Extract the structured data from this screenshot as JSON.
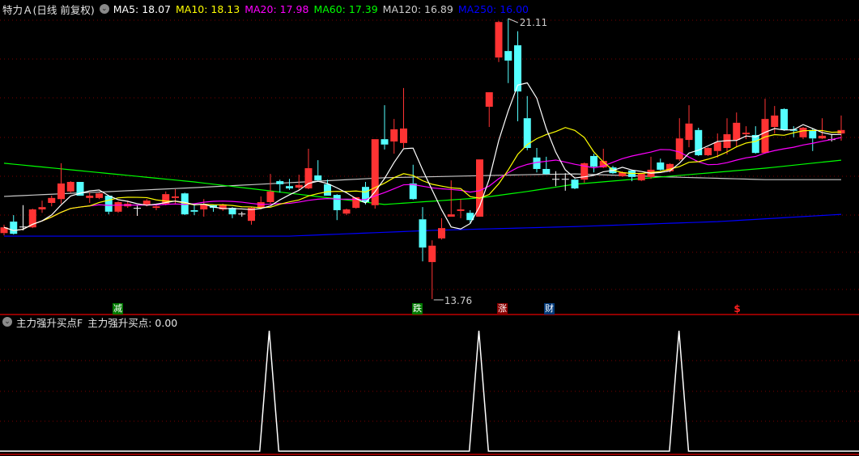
{
  "header": {
    "title": "特力Ａ(日线 前复权)",
    "ma_labels": [
      {
        "text": "MA5: 18.07",
        "color": "#ffffff"
      },
      {
        "text": "MA10: 18.13",
        "color": "#ffff00"
      },
      {
        "text": "MA20: 17.98",
        "color": "#ff00ff"
      },
      {
        "text": "MA60: 17.39",
        "color": "#00ff00"
      },
      {
        "text": "MA120: 16.89",
        "color": "#cccccc"
      },
      {
        "text": "MA250: 16.00",
        "color": "#0000ff"
      }
    ]
  },
  "annotations": {
    "high_label": "21.11",
    "low_label": "13.76"
  },
  "markers": [
    {
      "text": "减",
      "bg": "#007a00",
      "color": "#ffffff"
    },
    {
      "text": "跌",
      "bg": "#007a00",
      "color": "#ffffff"
    },
    {
      "text": "涨",
      "bg": "#8b0000",
      "color": "#ffffff"
    },
    {
      "text": "财",
      "bg": "#003a7a",
      "color": "#ffffff"
    },
    {
      "text": "$",
      "bg": "transparent",
      "color": "#ff2020"
    }
  ],
  "indicator": {
    "name": "主力强升买点F",
    "value_label": "主力强升买点: 0.00"
  },
  "colors": {
    "up": "#ff3333",
    "down": "#54ffff",
    "grid": "#7a0000",
    "separator": "#c00000"
  },
  "chart_data": {
    "type": "candlestick",
    "title": "特力Ａ(日线 前复权)",
    "ylim": [
      13.6,
      21.2
    ],
    "candles_ohlc": [
      [
        15.49,
        15.71,
        15.43,
        15.64
      ],
      [
        15.79,
        15.96,
        15.45,
        15.47
      ],
      [
        15.66,
        16.22,
        15.56,
        15.66
      ],
      [
        15.64,
        16.13,
        15.62,
        16.11
      ],
      [
        16.11,
        16.34,
        16.02,
        16.17
      ],
      [
        16.28,
        16.47,
        16.19,
        16.41
      ],
      [
        16.38,
        17.32,
        16.26,
        16.79
      ],
      [
        16.58,
        16.85,
        16.55,
        16.83
      ],
      [
        16.83,
        16.83,
        16.47,
        16.47
      ],
      [
        16.41,
        16.55,
        16.28,
        16.47
      ],
      [
        16.41,
        16.55,
        16.38,
        16.53
      ],
      [
        16.47,
        16.47,
        15.98,
        16.05
      ],
      [
        16.05,
        16.32,
        16.02,
        16.3
      ],
      [
        16.19,
        16.34,
        16.15,
        16.26
      ],
      [
        16.15,
        16.22,
        15.94,
        16.15
      ],
      [
        16.24,
        16.38,
        16.19,
        16.34
      ],
      [
        16.15,
        16.26,
        16.09,
        16.19
      ],
      [
        16.24,
        16.58,
        16.22,
        16.51
      ],
      [
        16.41,
        16.64,
        16.24,
        16.45
      ],
      [
        16.53,
        16.55,
        15.96,
        15.98
      ],
      [
        16.09,
        16.24,
        15.96,
        16.05
      ],
      [
        16.11,
        16.38,
        15.92,
        16.24
      ],
      [
        16.22,
        16.24,
        16.05,
        16.15
      ],
      [
        16.11,
        16.26,
        16.07,
        16.24
      ],
      [
        16.15,
        16.17,
        15.88,
        15.98
      ],
      [
        15.98,
        16.05,
        15.92,
        16.0
      ],
      [
        15.81,
        16.17,
        15.71,
        16.15
      ],
      [
        16.15,
        16.45,
        16.11,
        16.3
      ],
      [
        16.3,
        17.04,
        16.26,
        16.58
      ],
      [
        16.85,
        16.89,
        16.55,
        16.77
      ],
      [
        16.72,
        16.91,
        16.62,
        16.66
      ],
      [
        16.68,
        17.02,
        16.62,
        16.75
      ],
      [
        16.66,
        17.7,
        16.64,
        17.19
      ],
      [
        17.0,
        17.4,
        16.83,
        16.87
      ],
      [
        16.77,
        16.89,
        16.47,
        16.47
      ],
      [
        16.49,
        16.51,
        15.83,
        16.09
      ],
      [
        16.0,
        16.13,
        15.96,
        16.11
      ],
      [
        16.15,
        16.43,
        16.13,
        16.43
      ],
      [
        16.7,
        16.83,
        16.24,
        16.3
      ],
      [
        16.22,
        17.95,
        16.13,
        17.95
      ],
      [
        17.95,
        18.84,
        17.68,
        17.81
      ],
      [
        17.89,
        18.48,
        17.57,
        18.21
      ],
      [
        17.85,
        19.29,
        17.72,
        18.23
      ],
      [
        16.79,
        17.28,
        16.36,
        16.38
      ],
      [
        15.85,
        16.17,
        14.75,
        15.11
      ],
      [
        14.73,
        15.3,
        13.76,
        15.16
      ],
      [
        15.35,
        15.88,
        15.32,
        15.62
      ],
      [
        15.92,
        16.87,
        15.92,
        15.98
      ],
      [
        16.07,
        16.38,
        15.88,
        16.11
      ],
      [
        16.02,
        16.09,
        15.73,
        15.83
      ],
      [
        15.92,
        17.42,
        15.92,
        17.42
      ],
      [
        18.8,
        19.18,
        18.27,
        19.18
      ],
      [
        20.09,
        21.05,
        19.97,
        21.02
      ],
      [
        20.26,
        21.11,
        19.42,
        20.01
      ],
      [
        20.41,
        20.78,
        18.42,
        19.2
      ],
      [
        18.5,
        19.08,
        17.66,
        17.72
      ],
      [
        17.47,
        17.72,
        17.08,
        17.17
      ],
      [
        17.17,
        17.49,
        17.02,
        17.04
      ],
      [
        16.91,
        17.11,
        16.72,
        16.91
      ],
      [
        16.91,
        17.06,
        16.6,
        16.89
      ],
      [
        16.89,
        16.91,
        16.64,
        16.66
      ],
      [
        16.89,
        17.34,
        16.81,
        17.32
      ],
      [
        17.51,
        17.57,
        17.08,
        17.23
      ],
      [
        17.21,
        17.7,
        17.19,
        17.38
      ],
      [
        17.21,
        17.25,
        17.04,
        17.06
      ],
      [
        16.98,
        17.11,
        16.96,
        17.08
      ],
      [
        17.13,
        17.15,
        16.85,
        16.96
      ],
      [
        16.87,
        17.06,
        16.85,
        17.04
      ],
      [
        16.96,
        17.49,
        16.91,
        17.15
      ],
      [
        17.34,
        17.44,
        17.13,
        17.15
      ],
      [
        17.11,
        17.32,
        17.08,
        17.3
      ],
      [
        17.42,
        18.5,
        17.38,
        17.97
      ],
      [
        17.93,
        18.84,
        17.74,
        18.36
      ],
      [
        18.19,
        18.25,
        17.51,
        17.53
      ],
      [
        17.53,
        17.74,
        17.51,
        17.72
      ],
      [
        17.64,
        18.1,
        17.47,
        17.87
      ],
      [
        17.72,
        18.5,
        17.55,
        18.08
      ],
      [
        17.93,
        18.65,
        17.74,
        18.38
      ],
      [
        18.08,
        18.29,
        17.95,
        18.12
      ],
      [
        18.06,
        18.29,
        17.57,
        17.59
      ],
      [
        17.59,
        19.01,
        17.57,
        18.48
      ],
      [
        18.27,
        18.82,
        18.1,
        18.57
      ],
      [
        18.74,
        18.76,
        18.17,
        18.19
      ],
      [
        18.21,
        18.29,
        18.0,
        18.17
      ],
      [
        18.0,
        18.27,
        17.95,
        18.25
      ],
      [
        18.19,
        18.23,
        17.64,
        17.97
      ],
      [
        17.97,
        18.5,
        17.95,
        18.04
      ],
      [
        17.95,
        18.08,
        17.89,
        17.93
      ],
      [
        18.1,
        18.57,
        17.91,
        18.19
      ]
    ],
    "ma_long": {
      "MA60": [
        [
          0,
          17.32
        ],
        [
          20,
          16.83
        ],
        [
          40,
          16.24
        ],
        [
          50,
          16.41
        ],
        [
          55,
          16.58
        ],
        [
          60,
          16.77
        ],
        [
          70,
          16.98
        ],
        [
          80,
          17.19
        ],
        [
          88,
          17.4
        ]
      ],
      "MA120": [
        [
          0,
          16.45
        ],
        [
          20,
          16.68
        ],
        [
          40,
          16.94
        ],
        [
          55,
          17.02
        ],
        [
          60,
          17.04
        ],
        [
          70,
          16.96
        ],
        [
          80,
          16.89
        ],
        [
          88,
          16.89
        ]
      ],
      "MA250": [
        [
          0,
          15.41
        ],
        [
          30,
          15.41
        ],
        [
          45,
          15.56
        ],
        [
          60,
          15.66
        ],
        [
          75,
          15.79
        ],
        [
          88,
          15.98
        ]
      ]
    },
    "high_point": {
      "index": 53,
      "value": 21.11
    },
    "low_point": {
      "index": 45,
      "value": 13.76
    },
    "marker_indices": [
      12,
      43,
      52,
      57,
      77
    ],
    "indicator_signal_indices": [
      28,
      50,
      71
    ],
    "indicator_range": [
      0,
      1
    ]
  }
}
